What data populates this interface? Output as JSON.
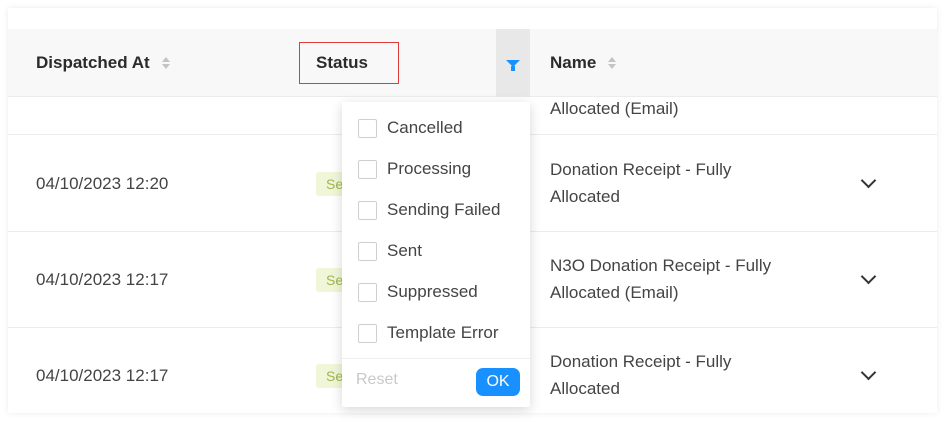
{
  "table": {
    "columns": {
      "dispatched_at": "Dispatched At",
      "status": "Status",
      "name": "Name"
    },
    "partial_row": {
      "name": "Allocated (Email)"
    },
    "rows": [
      {
        "dispatched_at": "04/10/2023 12:20",
        "status": "Se",
        "name_line1": "Donation Receipt - Fully",
        "name_line2": "Allocated"
      },
      {
        "dispatched_at": "04/10/2023 12:17",
        "status": "Se",
        "name_line1": "N3O Donation Receipt - Fully",
        "name_line2": "Allocated (Email)"
      },
      {
        "dispatched_at": "04/10/2023 12:17",
        "status": "Se",
        "name_line1": "Donation Receipt - Fully",
        "name_line2": "Allocated"
      }
    ]
  },
  "status_filter": {
    "options": [
      {
        "label": "Cancelled",
        "checked": false
      },
      {
        "label": "Processing",
        "checked": false
      },
      {
        "label": "Sending Failed",
        "checked": false
      },
      {
        "label": "Sent",
        "checked": false
      },
      {
        "label": "Suppressed",
        "checked": false
      },
      {
        "label": "Template Error",
        "checked": false
      }
    ],
    "reset_label": "Reset",
    "ok_label": "OK"
  },
  "colors": {
    "accent": "#1890ff",
    "highlight_border": "#e03a3a",
    "status_badge_bg": "#f0f7d9",
    "status_badge_text": "#9fb64d"
  }
}
